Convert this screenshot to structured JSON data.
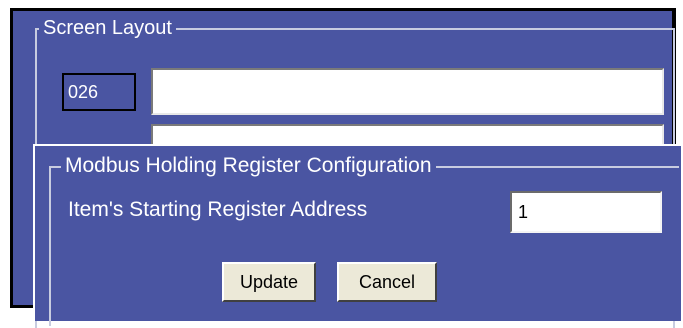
{
  "screen_layout": {
    "legend": "Screen Layout",
    "item_id": "026",
    "field_1_value": "",
    "field_2_value": ""
  },
  "modbus_dialog": {
    "legend": "Modbus Holding Register Configuration",
    "start_address_label": "Item's Starting Register Address",
    "start_address_value": "1",
    "update_label": "Update",
    "cancel_label": "Cancel"
  },
  "colors": {
    "panel_background": "#4a55a2",
    "button_face": "#ece9d8",
    "text_light": "#ffffff"
  }
}
